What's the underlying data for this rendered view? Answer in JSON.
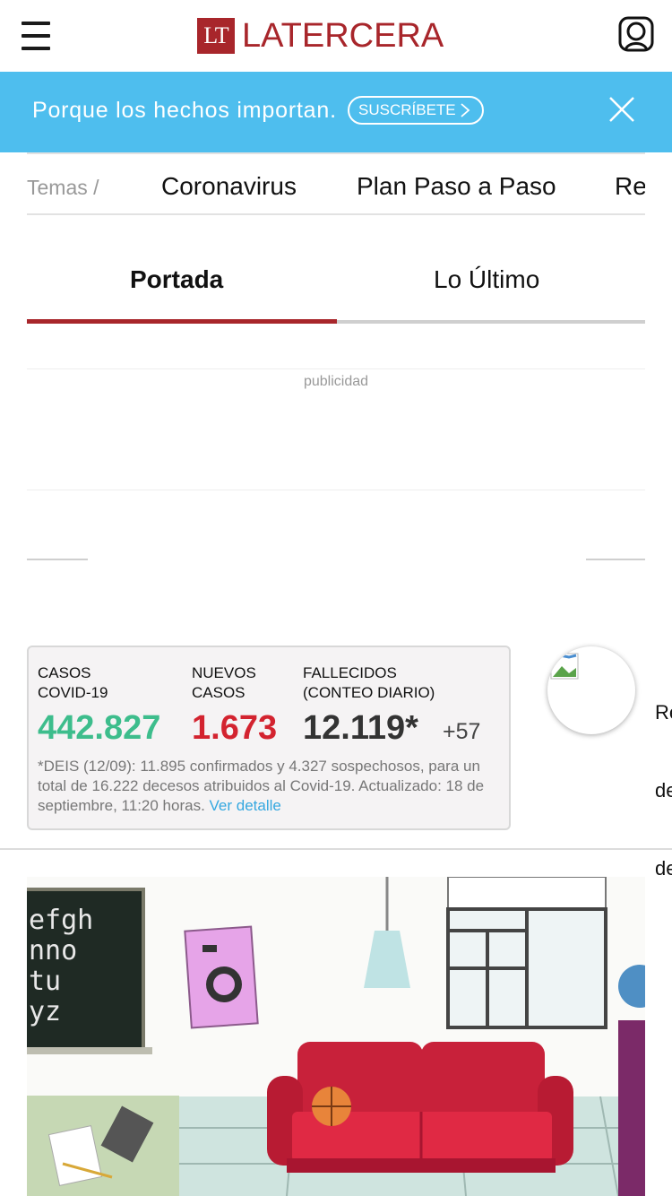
{
  "header": {
    "menu_icon": "hamburger-menu-icon",
    "logo_mark": "LT",
    "logo_text": "LATERCERA",
    "user_icon": "user-account-icon",
    "brand_color": "#a8262b"
  },
  "banner": {
    "text": "Porque los hechos importan.",
    "subscribe_label": "SUSCRÍBETE",
    "close_icon": "close-icon",
    "background": "#4ebeee"
  },
  "topics": {
    "label": "Temas /",
    "items": [
      "Coronavirus",
      "Plan Paso a Paso",
      "Re"
    ]
  },
  "tabs": [
    {
      "label": "Portada",
      "active": true
    },
    {
      "label": "Lo Último",
      "active": false
    }
  ],
  "ad": {
    "label": "publicidad"
  },
  "covid": {
    "stats": [
      {
        "label": "CASOS COVID-19",
        "label_lines": [
          "CASOS",
          "COVID-19"
        ],
        "value": "442.827",
        "color": "#3dbd8c"
      },
      {
        "label": "NUEVOS CASOS",
        "label_lines": [
          "NUEVOS",
          "CASOS"
        ],
        "value": "1.673",
        "color": "#d3232f"
      },
      {
        "label": "FALLECIDOS (CONTEO DIARIO)",
        "label_lines": [
          "FALLECIDOS",
          "(CONTEO DIARIO)"
        ],
        "value": "12.119*",
        "extra": "+57",
        "color": "#333333"
      }
    ],
    "note": "*DEIS (12/09): 11.895 confirmados y 4.327 sospechosos, para un total de 16.222 decesos atribuidos al Covid-19. Actualizado: 18 de septiembre, 11:20 horas.",
    "detail_link": "Ver detalle"
  },
  "promo": {
    "image_icon": "broken-image-icon",
    "text_lines": [
      "Re",
      "de",
      "de"
    ]
  },
  "hero": {
    "image_icon": "living-room-illustration",
    "chalkboard_lines": [
      "efgh",
      "nno",
      "tu",
      "yz"
    ]
  }
}
